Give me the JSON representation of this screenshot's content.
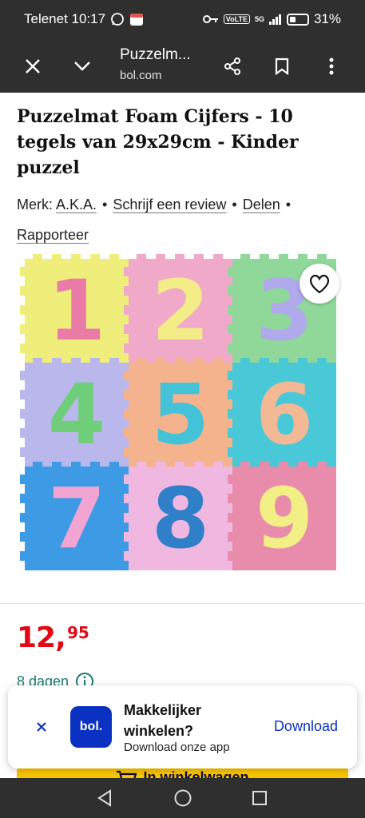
{
  "status_bar": {
    "carrier_time": "Telenet 10:17",
    "network": "5G",
    "volte": "VoLTE",
    "battery": "31%"
  },
  "browser": {
    "tab_title": "Puzzelm...",
    "url": "bol.com"
  },
  "product": {
    "title": "Puzzelmat Foam Cijfers - 10 tegels van 29x29cm - Kinder puzzel",
    "brand_label": "Merk:",
    "brand_value": "A.K.A.",
    "review_link": "Schrijf een review",
    "share_link": "Delen",
    "report_link": "Rapporteer",
    "tile_numbers": [
      "1",
      "2",
      "3",
      "4",
      "5",
      "6",
      "7",
      "8",
      "9"
    ],
    "price_euros": "12,",
    "price_cents": "95",
    "delivery_text": "8 dagen",
    "cart_button": "In winkelwagen"
  },
  "app_banner": {
    "logo": "bol.",
    "headline": "Makkelijker winkelen?",
    "subtext": "Download onze app",
    "download": "Download"
  },
  "colors": {
    "bar_bg": "#2f2f2f",
    "price_red": "#e30613",
    "bol_blue": "#0b31c2",
    "delivery_green": "#1c7a6c",
    "cart_yellow": "#fbc500"
  }
}
